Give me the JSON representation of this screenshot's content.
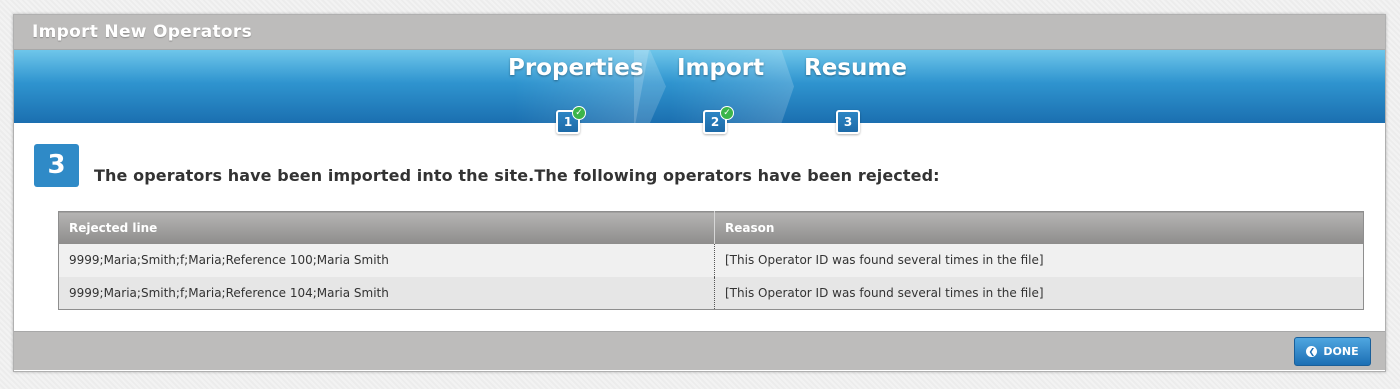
{
  "dialog": {
    "title": "Import New Operators"
  },
  "wizard": {
    "steps": [
      {
        "label": "Properties",
        "number": "1",
        "completed": true
      },
      {
        "label": "Import",
        "number": "2",
        "completed": true
      },
      {
        "label": "Resume",
        "number": "3",
        "completed": false
      }
    ],
    "check_glyph": "✓"
  },
  "content": {
    "step_badge": "3",
    "message": "The operators have been imported into the site.The following operators have been rejected:",
    "table": {
      "columns": [
        "Rejected line",
        "Reason"
      ],
      "rows": [
        {
          "line": "9999;Maria;Smith;f;Maria;Reference 100;Maria Smith",
          "reason": "[This Operator ID was found several times in the file]"
        },
        {
          "line": "9999;Maria;Smith;f;Maria;Reference 104;Maria Smith",
          "reason": "[This Operator ID was found several times in the file]"
        }
      ]
    }
  },
  "footer": {
    "done_label": "DONE",
    "done_icon": "back-arrow-icon"
  },
  "colors": {
    "accent": "#2f8ac7",
    "header_gray": "#bdbcbb",
    "success": "#3cb54a"
  }
}
